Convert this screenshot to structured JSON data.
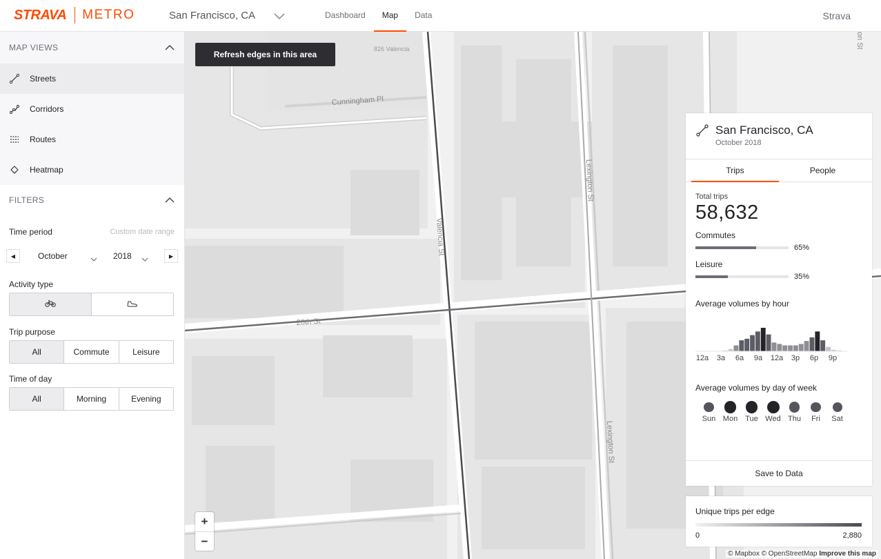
{
  "header": {
    "logo_strava": "STRAVA",
    "logo_metro": "METRO",
    "city": "San Francisco, CA",
    "nav": [
      {
        "label": "Dashboard",
        "active": false
      },
      {
        "label": "Map",
        "active": true
      },
      {
        "label": "Data",
        "active": false
      }
    ],
    "right_link": "Strava"
  },
  "sidebar": {
    "map_views_title": "MAP VIEWS",
    "views": [
      {
        "label": "Streets",
        "icon": "streets-icon",
        "active": true
      },
      {
        "label": "Corridors",
        "icon": "corridors-icon",
        "active": false
      },
      {
        "label": "Routes",
        "icon": "routes-icon",
        "active": false
      },
      {
        "label": "Heatmap",
        "icon": "heatmap-icon",
        "active": false
      }
    ],
    "filters_title": "FILTERS",
    "time_period_label": "Time period",
    "custom_range_link": "Custom date range",
    "month": "October",
    "year": "2018",
    "activity_type_label": "Activity type",
    "activity_options": [
      {
        "icon": "bike-icon",
        "selected": true
      },
      {
        "icon": "run-shoe-icon",
        "selected": false
      }
    ],
    "trip_purpose_label": "Trip purpose",
    "trip_purpose_options": [
      {
        "label": "All",
        "selected": true
      },
      {
        "label": "Commute",
        "selected": false
      },
      {
        "label": "Leisure",
        "selected": false
      }
    ],
    "time_of_day_label": "Time of day",
    "time_of_day_options": [
      {
        "label": "All",
        "selected": true
      },
      {
        "label": "Morning",
        "selected": false
      },
      {
        "label": "Evening",
        "selected": false
      }
    ]
  },
  "map": {
    "refresh_button": "Refresh edges in this area",
    "street_labels": {
      "valencia": "Valencia St",
      "lexington_top": "Lexington St",
      "lexington_bottom": "Lexington St",
      "cunningham": "Cunningham Pl",
      "twentieth": "20th St",
      "address": "826 Valencia",
      "corner": "on St"
    },
    "zoom_in": "+",
    "zoom_out": "−",
    "attribution_mapbox": "© Mapbox",
    "attribution_osm": "© OpenStreetMap",
    "attribution_improve": "Improve this map"
  },
  "panel": {
    "title": "San Francisco, CA",
    "subtitle": "October 2018",
    "tabs": [
      {
        "label": "Trips",
        "active": true
      },
      {
        "label": "People",
        "active": false
      }
    ],
    "total_trips_label": "Total trips",
    "total_trips_value": "58,632",
    "commutes_label": "Commutes",
    "commutes_pct": "65%",
    "commutes_fraction": 0.65,
    "leisure_label": "Leisure",
    "leisure_pct": "35%",
    "leisure_fraction": 0.35,
    "hour_chart_title": "Average volumes by hour",
    "hour_ticks": [
      "12a",
      "3a",
      "6a",
      "9a",
      "12a",
      "3p",
      "6p",
      "9p"
    ],
    "dow_title": "Average volumes by day of week",
    "save_button": "Save to Data"
  },
  "chart_data": {
    "type": "bar",
    "title": "Average volumes by hour",
    "categories": [
      "0",
      "1",
      "2",
      "3",
      "4",
      "5",
      "6",
      "7",
      "8",
      "9",
      "10",
      "11",
      "12",
      "13",
      "14",
      "15",
      "16",
      "17",
      "18",
      "19",
      "20",
      "21",
      "22",
      "23"
    ],
    "values": [
      0,
      0,
      0,
      0,
      0,
      1,
      3,
      8,
      15,
      17,
      22,
      27,
      32,
      23,
      12,
      10,
      8,
      8,
      8,
      10,
      14,
      19,
      27,
      15,
      6,
      2,
      1,
      0
    ],
    "highlight_color": "#242428",
    "bar_color": "#8e8e96"
  },
  "dow_data": {
    "days": [
      "Sun",
      "Mon",
      "Tue",
      "Wed",
      "Thu",
      "Fri",
      "Sat"
    ],
    "relative_volume": [
      0.55,
      0.95,
      0.95,
      1.0,
      0.7,
      0.6,
      0.5
    ]
  },
  "legend": {
    "title": "Unique trips per edge",
    "min": "0",
    "max": "2,880"
  },
  "colors": {
    "accent": "#fc4c02",
    "dark": "#242428",
    "map_bg": "#f1f1f1"
  }
}
